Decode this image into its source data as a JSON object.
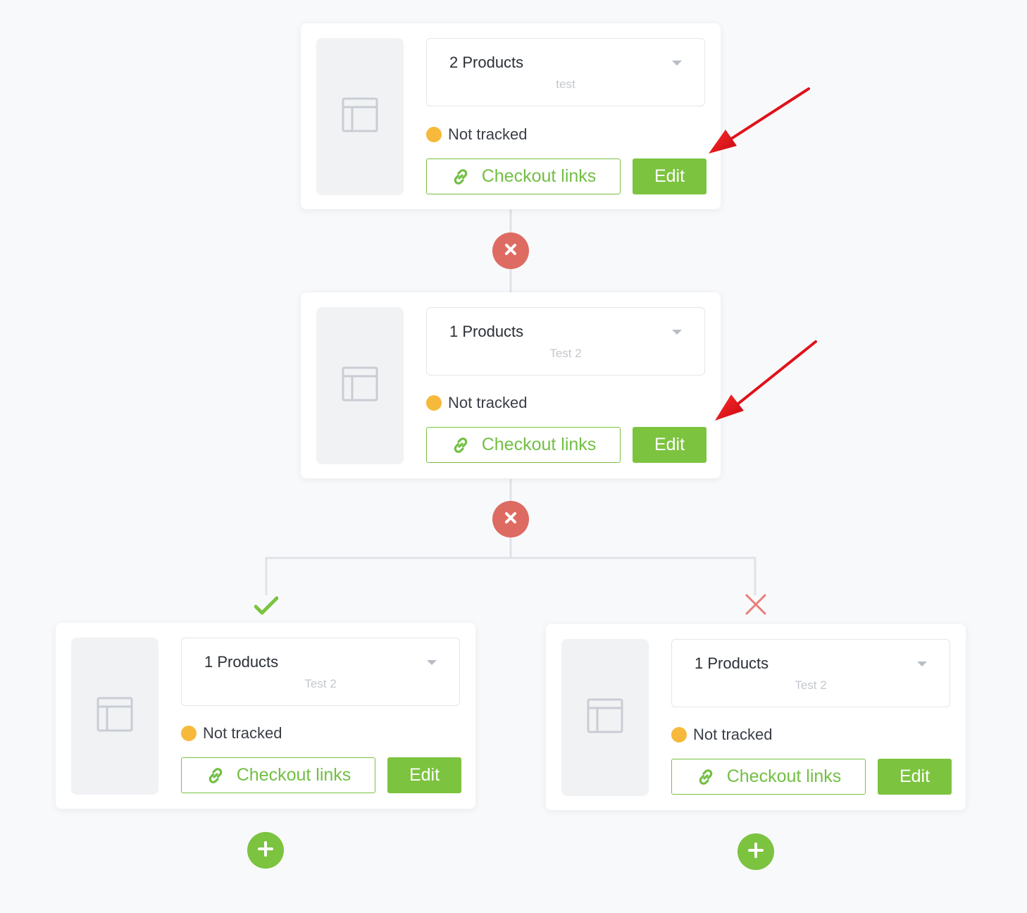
{
  "colors": {
    "accent_green": "#7cc33f",
    "remove_red": "#dd6b62",
    "status_pending": "#f6b93b",
    "annotation_arrow": "#e0111a"
  },
  "steps": [
    {
      "product_count": "2 Products",
      "product_name": "test",
      "status_text": "Not tracked",
      "checkout_links_label": "Checkout links",
      "edit_label": "Edit"
    },
    {
      "product_count": "1 Products",
      "product_name": "Test 2",
      "status_text": "Not tracked",
      "checkout_links_label": "Checkout links",
      "edit_label": "Edit"
    },
    {
      "product_count": "1 Products",
      "product_name": "Test 2",
      "status_text": "Not tracked",
      "checkout_links_label": "Checkout links",
      "edit_label": "Edit"
    },
    {
      "product_count": "1 Products",
      "product_name": "Test 2",
      "status_text": "Not tracked",
      "checkout_links_label": "Checkout links",
      "edit_label": "Edit"
    }
  ],
  "branches": {
    "yes_icon": "check-icon",
    "no_icon": "cross-icon"
  },
  "node_actions": {
    "remove_icon": "close-icon",
    "add_icon": "plus-icon"
  },
  "annotations": {
    "arrow_icon": "red-arrow-pointer",
    "arrow_targets": [
      "edit-button",
      "edit-button"
    ]
  }
}
